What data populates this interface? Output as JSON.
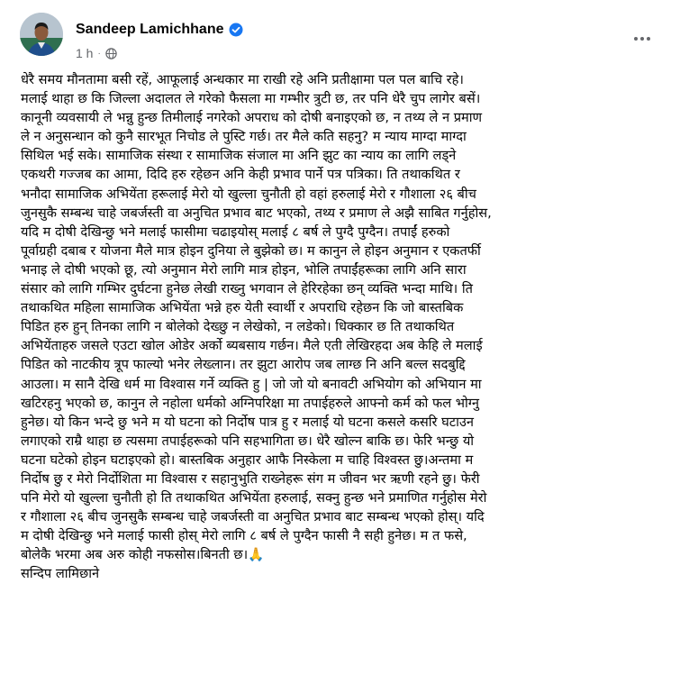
{
  "post": {
    "author": {
      "name": "Sandeep Lamichhane",
      "verified": true
    },
    "timestamp": "1 h",
    "privacy_icon": "globe-icon",
    "more_icon": "more-horizontal-icon",
    "lines": [
      "धेरै समय मौनतामा बसी रहें, आफूलाई अन्धकार मा राखी रहे अनि प्रतीक्षामा पल पल बाचि रहे।",
      "मलाई थाहा छ कि जिल्ला अदालत ले गरेको फैसला मा गम्भीर त्रुटी छ, तर पनि धेरै चुप लागेर बसें।",
      "कानूनी व्यवसायी ले भन्नु हुन्छ तिमीलाई नगरेको अपराध को दोषी बनाइएको छ, न तथ्य ले न प्रमाण",
      "ले न अनुसन्धान को कुनै सारभूत निचोड ले पुस्टि गर्छ। तर मैले कति सहनु? म न्याय माग्दा माग्दा",
      "सिथिल भई सके। सामाजिक संस्था र सामाजिक संजाल मा अनि झुट का न्याय का लागि लड्ने",
      "एकथरी गज्जब का आमा, दिदि हरु रहेछन अनि केही प्रभाव पार्ने पत्र पत्रिका। ति तथाकथित र",
      "भनौदा सामाजिक अभियेंता हरूलाई मेरो यो खुल्ला चुनौती हो वहां हरुलाई मेरो र गौशाला २६ बीच",
      "जुनसुकै सम्बन्ध चाहे जबर्जस्ती वा अनुचित प्रभाव बाट भएको, तथ्य र प्रमाण ले अझै साबित गर्नुहोस,",
      "यदि म दोषी देखिन्छु भने मलाई फासीमा चढाइयोस् मलाई ८ बर्ष ले पुग्दै पुग्दैन। तपाईं हरुको",
      "पूर्वाग्रही दबाब र योजना मैले मात्र होइन दुनिया ले बुझेको छ। म कानुन ले होइन अनुमान र एकतर्फी",
      "भनाइ ले दोषी भएको छू, त्यो अनुमान मेरो लागि मात्र होइन, भोलि तपाईंहरूका लागि अनि सारा",
      "संसार को लागि गम्भिर दुर्घटना हुनेछ लेखी राख्नु भगवान ले हेरिरहेका छन् व्यक्ति भन्दा माथि। ति",
      "तथाकथित महिला सामाजिक अभियेंता भन्ने हरु येती स्वार्थी र अपराधि रहेछन कि जो बास्तबिक",
      "पिडित हरु हुन् तिनका लागि न बोलेको देख्छु न लेखेको, न लडेको। धिक्कार छ ति तथाकथित",
      "अभियेंताहरु जसले एउटा खोल ओडेर अर्को ब्यबसाय गर्छन। मैले एती लेखिरहदा अब केहि ले मलाई",
      "पिडित को नाटकीय त्रूप फाल्यो भनेर लेख्लान। तर झुटा आरोप जब लाग्छ नि अनि बल्ल सदबुद्दि",
      "आउला। म सानै देखि धर्म मा विश्वास गर्ने व्यक्ति हु | जो जो यो बनावटी अभियोग को अभियान मा",
      "खटिरहनु भएको छ, कानुन ले नहोला धर्मको अग्निपरिक्षा मा तपाईहरुले आफ्नो कर्म को फल भोग्नु",
      "हुनेछ। यो किन भन्दे छु भने म यो घटना को निर्दोष पात्र हु र मलाई यो घटना कसले कसरि घटाउन",
      "लगाएको राम्रै थाहा छ त्यसमा तपाईहरूको पनि सहभागिता छ। धेरै खोल्न बाकि छ। फेरि भन्छु यो",
      "घटना घटेको होइन घटाइएको हो। बास्तबिक अनुहार आफै निस्केला म चाहि विश्वस्त छु।अन्तमा म",
      "निर्दोष छु र मेरो निर्दोशिता मा विश्वास र सहानुभुति राख्नेहरू संग म जीवन भर ऋणी रहने छु। फेरी",
      "पनि मेरो यो खुल्ला चुनौती हो ति तथाकथित अभियेंता हरुलाई, सक्नु हुन्छ भने प्रमाणित गर्नुहोस मेरो",
      "र गौशाला २६ बीच जुनसुकै सम्बन्ध चाहे जबर्जस्ती वा अनुचित प्रभाव बाट सम्बन्ध भएको होस्। यदि",
      "म दोषी देखिन्छु भने मलाई फासी होस् मेरो लागि ८ बर्ष ले पुग्दैन फासी नै सही हुनेछ। म त फसे,",
      "बोलेकै भरमा अब अरु कोही नफसोस।बिनती छ।🙏"
    ],
    "signature": "सन्दिप लामिछाने"
  },
  "colors": {
    "text": "#050505",
    "meta": "#65676b",
    "verified_badge": "#1877f2",
    "background": "#ffffff"
  }
}
